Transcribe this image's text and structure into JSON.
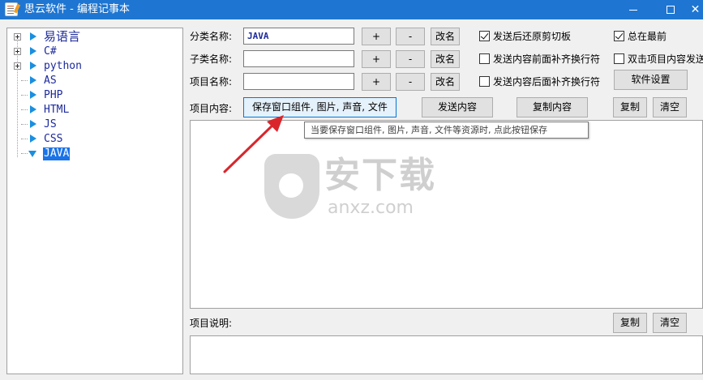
{
  "window": {
    "title": "思云软件 - 编程记事本",
    "min_label": "",
    "max_label": "",
    "close_label": "✕"
  },
  "tree": {
    "items": [
      {
        "label": "易语言",
        "expandable": true
      },
      {
        "label": "C#",
        "expandable": true
      },
      {
        "label": "python",
        "expandable": true
      },
      {
        "label": "AS",
        "expandable": false
      },
      {
        "label": "PHP",
        "expandable": false
      },
      {
        "label": "HTML",
        "expandable": false
      },
      {
        "label": "JS",
        "expandable": false
      },
      {
        "label": "CSS",
        "expandable": false
      },
      {
        "label": "JAVA",
        "expandable": false,
        "selected": true
      }
    ]
  },
  "form": {
    "category_label": "分类名称:",
    "category_value": "JAVA",
    "subcategory_label": "子类名称:",
    "subcategory_value": "",
    "item_label": "项目名称:",
    "item_value": "",
    "plus": "+",
    "minus": "-",
    "rename": "改名"
  },
  "options": {
    "restore_clipboard": "发送后还原剪切板",
    "restore_clipboard_checked": true,
    "always_on_top": "总在最前",
    "always_on_top_checked": true,
    "prefix_newline": "发送内容前面补齐换行符",
    "prefix_newline_checked": false,
    "double_click_send": "双击项目内容发送",
    "double_click_send_checked": false,
    "suffix_newline": "发送内容后面补齐换行符",
    "suffix_newline_checked": false,
    "settings_button": "软件设置"
  },
  "content": {
    "label": "项目内容:",
    "save_button": "保存窗口组件, 图片, 声音, 文件",
    "send_button": "发送内容",
    "copy_content_button": "复制内容",
    "copy_button": "复制",
    "clear_button": "清空",
    "tooltip": "当要保存窗口组件, 图片, 声音, 文件等资源时, 点此按钮保存"
  },
  "description": {
    "label": "项目说明:",
    "copy_button": "复制",
    "clear_button": "清空"
  },
  "watermark": {
    "cn": "安下载",
    "en": "anxz.com"
  },
  "colors": {
    "titlebar": "#1e76d2",
    "tree_text": "#1c2a9c",
    "tree_arrow": "#1a8fe0",
    "selection": "#1a73e8",
    "annotation_arrow": "#d9262c"
  }
}
